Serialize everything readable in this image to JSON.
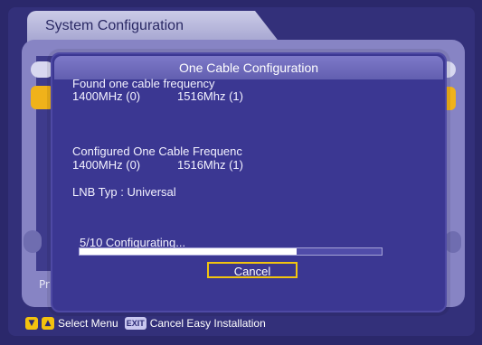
{
  "window": {
    "title": "System Configuration"
  },
  "dialog": {
    "title": "One Cable Configuration",
    "found_label": "Found one cable frequency",
    "found_freq_a": "1400MHz (0)",
    "found_freq_b": "1516Mhz (1)",
    "configured_label": "Configured One Cable Frequenc",
    "configured_freq_a": "1400MHz (0)",
    "configured_freq_b": "1516Mhz (1)",
    "lnb_label": "LNB Typ : Universal",
    "progress_text": "5/10  Configurating...",
    "progress_fraction": 0.72,
    "cancel_label": "Cancel"
  },
  "background": {
    "partial_text": "Pr"
  },
  "footer": {
    "select_label": "Select Menu",
    "exit_badge": "EXIT",
    "cancel_text": "Cancel Easy Installation"
  },
  "colors": {
    "accent_yellow": "#f3c20e",
    "dialog_bg": "#3b3792",
    "header_bg": "#625fb0",
    "progress_fill": "#ffffff"
  },
  "icons": {
    "down_arrow": "▼",
    "up_arrow": "▲"
  }
}
